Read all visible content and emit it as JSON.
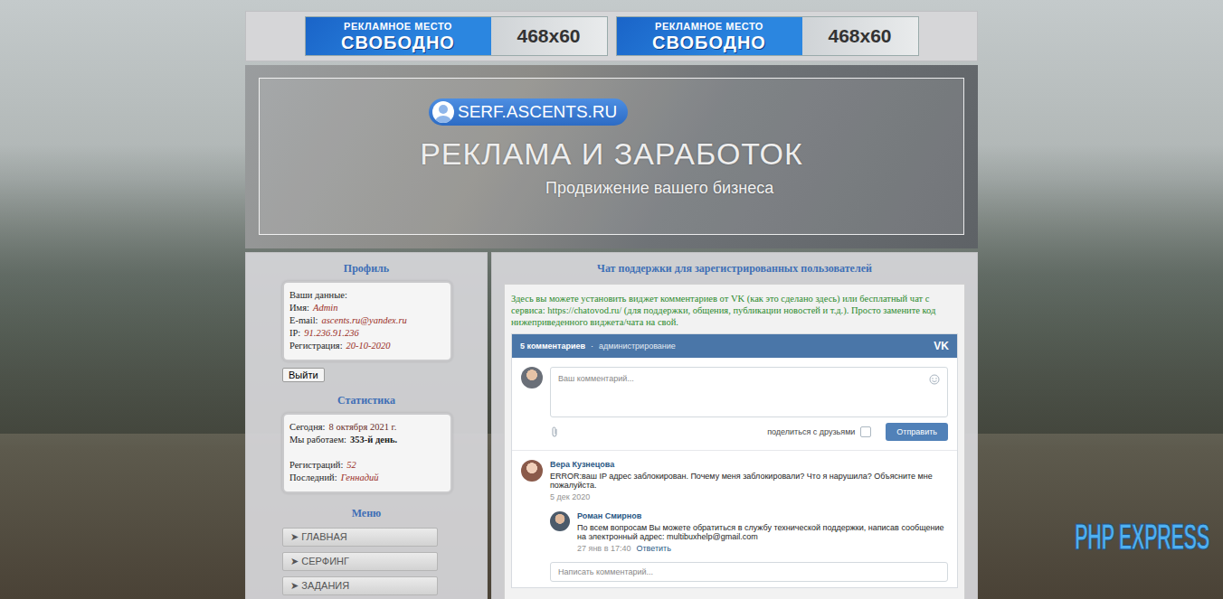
{
  "ads": [
    {
      "label": "РЕКЛАМНОЕ МЕСТО",
      "big": "СВОБОДНО",
      "size": "468x60"
    },
    {
      "label": "РЕКЛАМНОЕ МЕСТО",
      "big": "СВОБОДНО",
      "size": "468x60"
    }
  ],
  "header": {
    "logo": "SERF.ASCENTS.RU",
    "title": "РЕКЛАМА И ЗАРАБОТОК",
    "subtitle": "Продвижение вашего бизнеса"
  },
  "profile": {
    "heading": "Профиль",
    "caption": "Ваши данные:",
    "fields": [
      {
        "label": "Имя:",
        "value": "Admin",
        "kind": "italic"
      },
      {
        "label": "E-mail:",
        "value": "ascents.ru@yandex.ru",
        "kind": "italic"
      },
      {
        "label": "IP:",
        "value": "91.236.91.236",
        "kind": "italic"
      },
      {
        "label": "Регистрация:",
        "value": "20-10-2020",
        "kind": "italic"
      }
    ],
    "logout": "Выйти"
  },
  "stats": {
    "heading": "Статистика",
    "groups": [
      [
        {
          "label": "Сегодня:",
          "value": "8 октября 2021 г.",
          "kind": "plain"
        },
        {
          "label": "Мы работаем:",
          "value": "353-й день.",
          "kind": "bold"
        }
      ],
      [
        {
          "label": "Регистраций:",
          "value": "52",
          "kind": "italic"
        },
        {
          "label": "Последний:",
          "value": "Геннадий",
          "kind": "italic"
        }
      ]
    ]
  },
  "menu": {
    "heading": "Меню",
    "items": [
      "➤ ГЛАВНАЯ",
      "➤ СЕРФИНГ",
      "➤ ЗАДАНИЯ"
    ]
  },
  "chat": {
    "heading": "Чат поддержки для зарегистрированных пользователей",
    "intro": "Здесь вы можете установить виджет комментариев от VK (как это сделано здесь) или бесплатный чат с сервиса: https://chatovod.ru/ (для поддержки, общения, публикации новостей и т.д.). Просто замените код нижеприведенного виджета/чата на свой.",
    "widget": {
      "count": "5 комментариев",
      "separator": "·",
      "admin": "администрирование",
      "logo": "VK",
      "placeholder": "Ваш комментарий...",
      "share": "поделиться с друзьями",
      "share_checked": false,
      "send": "Отправить",
      "comments": [
        {
          "author": "Вера Кузнецова",
          "text": "ERROR:ваш IP адрес заблокирован. Почему меня заблокировали? Что я нарушила? Объясните мне пожалуйста.",
          "date": "5 дек 2020",
          "replies": [
            {
              "author": "Роман Смирнов",
              "text": "По всем вопросам Вы можете обратиться в службу технической поддержки, написав сообщение на электронный адрес: multibuxhelp@gmail.com",
              "date": "27 янв в 17:40",
              "action": "Ответить"
            }
          ]
        }
      ],
      "write": "Написать комментарий..."
    }
  },
  "watermark": "PHP EXPRESS"
}
